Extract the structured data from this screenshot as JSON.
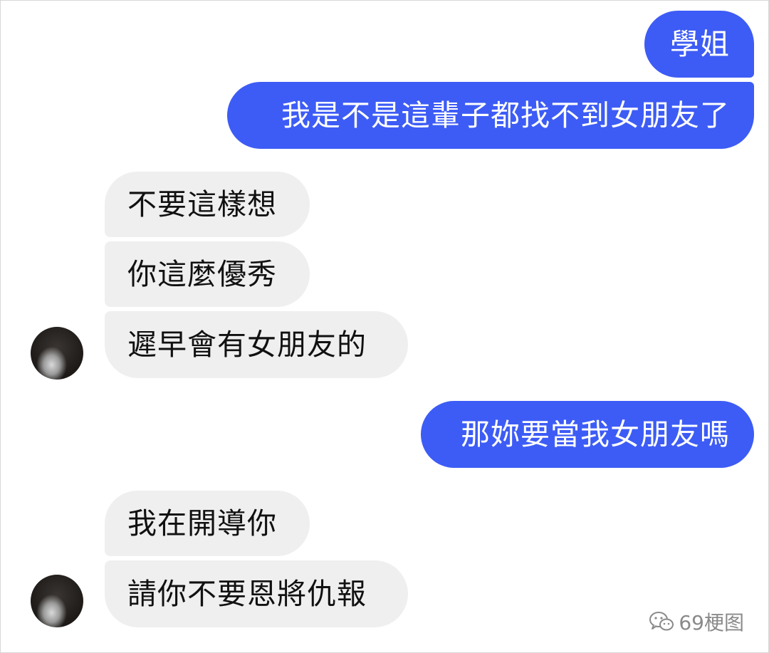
{
  "messages": [
    {
      "id": "b1",
      "side": "outgoing",
      "text": "學姐"
    },
    {
      "id": "b2",
      "side": "outgoing",
      "text": "我是不是這輩子都找不到女朋友了"
    },
    {
      "id": "b3",
      "side": "incoming",
      "text": "不要這樣想"
    },
    {
      "id": "b4",
      "side": "incoming",
      "text": "你這麼優秀"
    },
    {
      "id": "b5",
      "side": "incoming",
      "text": "遲早會有女朋友的"
    },
    {
      "id": "b6",
      "side": "outgoing",
      "text": "那妳要當我女朋友嗎"
    },
    {
      "id": "b7",
      "side": "incoming",
      "text": "我在開導你"
    },
    {
      "id": "b8",
      "side": "incoming",
      "text": "請你不要恩將仇報"
    }
  ],
  "watermark": {
    "icon": "wechat-icon",
    "text": "69梗图"
  },
  "colors": {
    "outgoing_bubble": "#3d5cf5",
    "incoming_bubble": "#efefef",
    "outgoing_text": "#ffffff",
    "incoming_text": "#111111"
  }
}
